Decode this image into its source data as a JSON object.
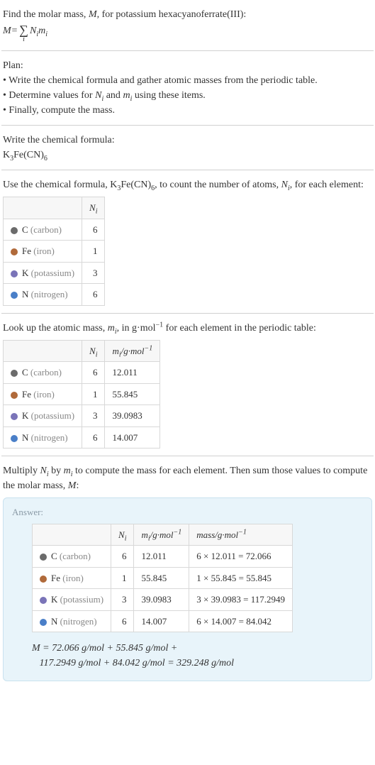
{
  "intro": {
    "line1_prefix": "Find the molar mass, ",
    "line1_var": "M",
    "line1_suffix": ", for potassium hexacyanoferrate(III):",
    "formula_lhs": "M",
    "formula_eq": " = ",
    "formula_sigma": "∑",
    "formula_sub": "i",
    "formula_rhs_n": "N",
    "formula_rhs_n_sub": "i",
    "formula_rhs_m": "m",
    "formula_rhs_m_sub": "i"
  },
  "plan": {
    "heading": "Plan:",
    "bullet": "•",
    "items": [
      "Write the chemical formula and gather atomic masses from the periodic table.",
      "Determine values for N_i and m_i using these items.",
      "Finally, compute the mass."
    ],
    "item2_prefix": "Determine values for ",
    "item2_n": "N",
    "item2_n_sub": "i",
    "item2_and": " and ",
    "item2_m": "m",
    "item2_m_sub": "i",
    "item2_suffix": " using these items."
  },
  "write_formula": {
    "heading": "Write the chemical formula:",
    "formula_k": "K",
    "formula_k_sub": "3",
    "formula_fe": "Fe(CN)",
    "formula_fe_sub": "6"
  },
  "count_atoms": {
    "prefix": "Use the chemical formula, ",
    "formula_k": "K",
    "formula_k_sub": "3",
    "formula_fe": "Fe(CN)",
    "formula_fe_sub": "6",
    "mid": ", to count the number of atoms, ",
    "n": "N",
    "n_sub": "i",
    "suffix": ", for each element:",
    "header_n": "N",
    "header_n_sub": "i"
  },
  "elements": [
    {
      "color": "#6b6b6b",
      "sym": "C",
      "name": "(carbon)",
      "n": "6",
      "m": "12.011",
      "mass": "6 × 12.011 = 72.066"
    },
    {
      "color": "#b06a3a",
      "sym": "Fe",
      "name": "(iron)",
      "n": "1",
      "m": "55.845",
      "mass": "1 × 55.845 = 55.845"
    },
    {
      "color": "#7a74b8",
      "sym": "K",
      "name": "(potassium)",
      "n": "3",
      "m": "39.0983",
      "mass": "3 × 39.0983 = 117.2949"
    },
    {
      "color": "#4a7fc8",
      "sym": "N",
      "name": "(nitrogen)",
      "n": "6",
      "m": "14.007",
      "mass": "6 × 14.007 = 84.042"
    }
  ],
  "lookup": {
    "prefix": "Look up the atomic mass, ",
    "m": "m",
    "m_sub": "i",
    "mid": ", in g·mol",
    "exp": "−1",
    "suffix": " for each element in the periodic table:",
    "header_n": "N",
    "header_n_sub": "i",
    "header_m": "m",
    "header_m_sub": "i",
    "header_m_unit": "/g·mol",
    "header_m_exp": "−1"
  },
  "multiply": {
    "prefix": "Multiply ",
    "n": "N",
    "n_sub": "i",
    "mid": " by ",
    "m": "m",
    "m_sub": "i",
    "suffix": " to compute the mass for each element. Then sum those values to compute the molar mass, ",
    "M": "M",
    "end": ":"
  },
  "answer": {
    "label": "Answer:",
    "header_n": "N",
    "header_n_sub": "i",
    "header_m": "m",
    "header_m_sub": "i",
    "header_m_unit": "/g·mol",
    "header_m_exp": "−1",
    "header_mass": "mass/g·mol",
    "header_mass_exp": "−1",
    "final_lhs": "M",
    "final_eq": " = ",
    "final_line1": "72.066 g/mol + 55.845 g/mol +",
    "final_line2": "117.2949 g/mol + 84.042 g/mol = 329.248 g/mol"
  }
}
